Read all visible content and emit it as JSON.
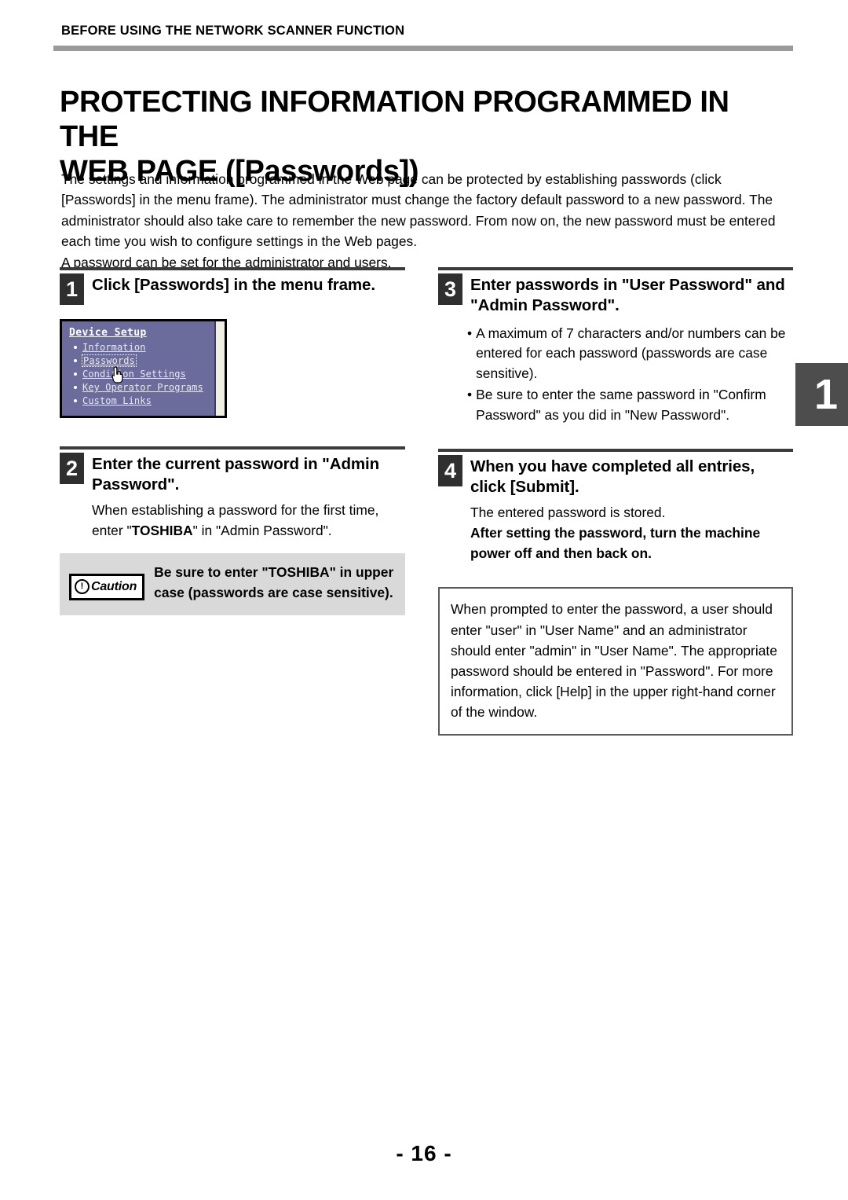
{
  "header": {
    "running_title": "BEFORE USING THE NETWORK SCANNER FUNCTION"
  },
  "title": {
    "line1": "PROTECTING INFORMATION PROGRAMMED IN THE",
    "line2": "WEB PAGE ([Passwords])"
  },
  "intro": {
    "paragraph1": "The settings and information programmed in the Web page can be protected by establishing passwords (click [Passwords] in the menu frame). The administrator must change the factory default password to a new password. The administrator should also take care to remember the new password. From now on, the new password must be entered each time you wish to configure settings in the Web pages.",
    "paragraph2": "A password can be set for the administrator and users."
  },
  "steps": {
    "step1": {
      "number": "1",
      "title": "Click [Passwords] in the menu frame."
    },
    "step2": {
      "number": "2",
      "title": "Enter the current password in \"Admin Password\".",
      "body_prefix": "When establishing a password for the first time, enter \"",
      "body_bold": "TOSHIBA",
      "body_suffix": "\" in \"Admin Password\"."
    },
    "step3": {
      "number": "3",
      "title": "Enter passwords in \"User Password\" and \"Admin Password\".",
      "bullets": [
        "A maximum of 7 characters and/or numbers can be entered for each password (passwords are case sensitive).",
        "Be sure to enter the same password in \"Confirm Password\" as you did in \"New Password\"."
      ],
      "bullet_marker": "•"
    },
    "step4": {
      "number": "4",
      "title": "When you have completed all entries, click [Submit].",
      "body_plain": "The entered password is stored.",
      "body_bold": "After setting the password, turn the machine power off and then back on."
    }
  },
  "menu_screenshot": {
    "heading": "Device Setup",
    "items": [
      {
        "label": "Information",
        "selected": false
      },
      {
        "label": "Passwords",
        "selected": true
      },
      {
        "label": "Condition Settings",
        "selected": false
      },
      {
        "label": "Key Operator Programs",
        "selected": false
      },
      {
        "label": "Custom Links",
        "selected": false
      }
    ],
    "cursor": "hand-cursor",
    "background_color": "#6c6c9c",
    "text_color": "#e8e8f4"
  },
  "caution": {
    "badge_symbol": "!",
    "badge_label": "Caution",
    "text": "Be sure to enter \"TOSHIBA\" in upper case  (passwords are case sensitive)."
  },
  "note": {
    "text": "When prompted to enter the password, a user should enter \"user\" in \"User Name\" and an administrator should enter \"admin\" in \"User Name\". The appropriate password should be entered in \"Password\". For more information, click [Help] in the upper right-hand corner of the window."
  },
  "chapter_tab": {
    "number": "1"
  },
  "footer": {
    "page_number": "- 16 -"
  }
}
